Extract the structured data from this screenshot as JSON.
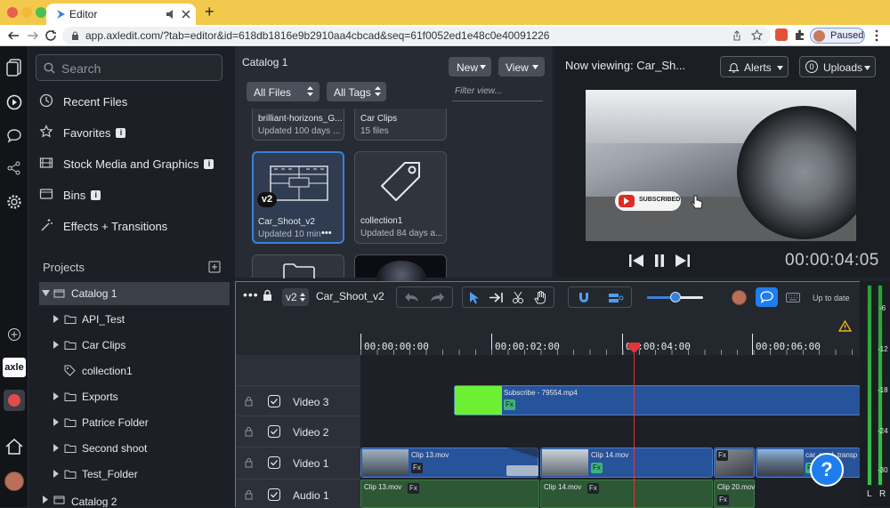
{
  "browser": {
    "tab_title": "Editor",
    "url": "app.axledit.com/?tab=editor&id=618db1816e9b2910aa4cbcad&seq=61f0052ed1e48c0e40091226",
    "profile_status": "Paused",
    "new_tab_symbol": "+"
  },
  "sidebar": {
    "search_placeholder": "Search",
    "nav": [
      {
        "label": "Recent Files",
        "icon": "clock-icon"
      },
      {
        "label": "Favorites",
        "icon": "star-icon",
        "info": "i"
      },
      {
        "label": "Stock Media and Graphics",
        "icon": "film-icon",
        "info": "i"
      },
      {
        "label": "Bins",
        "icon": "bin-icon",
        "info": "i"
      },
      {
        "label": "Effects + Transitions",
        "icon": "magic-wand-icon"
      }
    ],
    "projects_label": "Projects",
    "tree": [
      {
        "label": "Catalog 1",
        "level": 0,
        "selected": true
      },
      {
        "label": "API_Test",
        "level": 1
      },
      {
        "label": "Car Clips",
        "level": 1
      },
      {
        "label": "collection1",
        "level": 1,
        "tag": true
      },
      {
        "label": "Exports",
        "level": 1
      },
      {
        "label": "Patrice Folder",
        "level": 1
      },
      {
        "label": "Second shoot",
        "level": 1
      },
      {
        "label": "Test_Folder",
        "level": 1
      },
      {
        "label": "Catalog 2",
        "level": 0
      }
    ],
    "rail_logo": "axle"
  },
  "catalog": {
    "title": "Catalog 1",
    "new_button": "New",
    "view_button": "View",
    "filter_files": "All Files",
    "filter_tags": "All Tags",
    "filter_placeholder": "Filter view...",
    "cards": [
      {
        "name": "brilliant-horizons_G...",
        "meta": "Updated 100 days ..."
      },
      {
        "name": "Car Clips",
        "meta": "15 files"
      },
      {
        "name": "Car_Shoot_v2",
        "meta": "Updated 10 min",
        "badge": "v2",
        "more": "•••"
      },
      {
        "name": "collection1",
        "meta": "Updated 84 days a..."
      }
    ]
  },
  "preview": {
    "now_viewing": "Now viewing: Car_Sh...",
    "alerts": "Alerts",
    "uploads": "Uploads",
    "uploads_count": "0",
    "timecode": "00:00:04:05",
    "overlay_text": "SUBSCRIBED"
  },
  "timeline": {
    "version": "v2",
    "sequence_name": "Car_Shoot_v2",
    "status": "Up to date",
    "zoom_level": 0.5,
    "ruler": [
      "00:00:00:00",
      "00:00:02:00",
      "00:00:04:00",
      "00:00:06:00"
    ],
    "tracks": [
      "Video 3",
      "Video 2",
      "Video 1",
      "Audio 1"
    ],
    "clips": {
      "subscribe": "Subscribe - 79554.mp4",
      "clip13": "Clip 13.mov",
      "clip14": "Clip 14.mov",
      "car_road": "car_road_transp",
      "a_clip13": "Clip 13.mov",
      "a_clip14": "Clip 14.mov",
      "a_clip20": "Clip 20.mov",
      "fx": "Fx"
    },
    "help": "?"
  },
  "meter": {
    "labels": [
      "-6",
      "-12",
      "-18",
      "-24",
      "-30"
    ],
    "left": "L",
    "right": "R"
  },
  "colors": {
    "accent": "#3b80d8",
    "playhead": "#e0353a",
    "green_clip": "#6df034",
    "video_clip": "#27539a",
    "audio_clip": "#2e5735",
    "chrome": "#f2c94c"
  }
}
